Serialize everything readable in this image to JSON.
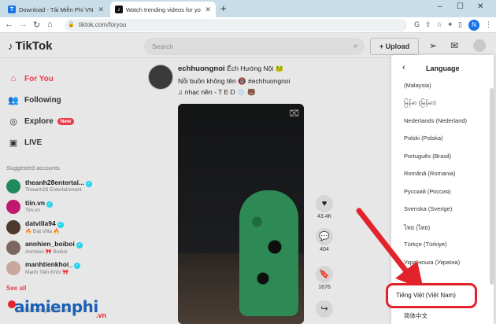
{
  "browser": {
    "tabs": [
      {
        "title": "Download - Tải Miễn Phí VN - Ph",
        "favicon_letter": "T",
        "favicon_color": "#1a73e8",
        "active": false
      },
      {
        "title": "Watch trending videos for yo",
        "favicon_letter": "♪",
        "favicon_color": "#111111",
        "active": true
      }
    ],
    "new_tab_label": "+",
    "window_controls": {
      "minimize": "–",
      "maximize": "☐",
      "close": "✕"
    },
    "url": "tiktok.com/foryou",
    "profile_letter": "N"
  },
  "header": {
    "logo": "TikTok",
    "search_placeholder": "Search",
    "upload_label": "+ Upload"
  },
  "sidebar": {
    "nav": [
      {
        "label": "For You",
        "icon": "home-icon",
        "active": true
      },
      {
        "label": "Following",
        "icon": "users-icon",
        "active": false
      },
      {
        "label": "Explore",
        "icon": "compass-icon",
        "active": false,
        "badge": "New"
      },
      {
        "label": "LIVE",
        "icon": "live-icon",
        "active": false
      }
    ],
    "suggested_title": "Suggested accounts",
    "accounts": [
      {
        "name": "theanh28entertai...",
        "sub": "Theanh28 Entertainment",
        "avatar_color": "#1f8a5c"
      },
      {
        "name": "tiin.vn",
        "sub": "Tiin.vn",
        "avatar_color": "#c0186e"
      },
      {
        "name": "datvilla94",
        "sub": "🔥 Đạt Villa 🔥",
        "avatar_color": "#4d3a2e"
      },
      {
        "name": "annhien_boiboi",
        "sub": "Annhien 🎀 Boiboi",
        "avatar_color": "#7b6660"
      },
      {
        "name": "manhtienkhoi_",
        "sub": "Mạnh Tiến Khôi 🎀",
        "avatar_color": "#c9a79c"
      }
    ],
    "see_all": "See all",
    "following_accounts": "Following accounts"
  },
  "post": {
    "username": "echhuongnoi",
    "display_name": "Ếch Hướng Nội 🐸",
    "caption": "Nỗi buồn không tên 🔞 #echhuongnoi",
    "music": "♫ nhạc nền - T E D ❄️ 🐻",
    "actions": [
      {
        "icon": "heart-icon",
        "glyph": "♥",
        "count": "43.4K"
      },
      {
        "icon": "comment-icon",
        "glyph": "💬",
        "count": "404"
      },
      {
        "icon": "bookmark-icon",
        "glyph": "🔖",
        "count": "1676"
      },
      {
        "icon": "share-icon",
        "glyph": "↪",
        "count": ""
      }
    ]
  },
  "language_panel": {
    "title": "Language",
    "languages": [
      "(Malaysia)",
      "မြန်မာ (မြန်မာ)",
      "Nederlands (Nederland)",
      "Polski (Polska)",
      "Português (Brasil)",
      "Română (Romania)",
      "Русский (Россия)",
      "Svenska (Sverige)",
      "ไทย (ไทย)",
      "Türkçe (Türkiye)",
      "Українська (Україна)"
    ],
    "highlighted": "Tiếng Việt (Việt Nam)",
    "after": "简体中文"
  },
  "watermark": {
    "brand": "aimienphi",
    "tld": ".vn"
  },
  "colors": {
    "tiktok_red": "#e83c4c",
    "highlight_red": "#e3232c",
    "watermark_blue": "#1a5fb4"
  }
}
